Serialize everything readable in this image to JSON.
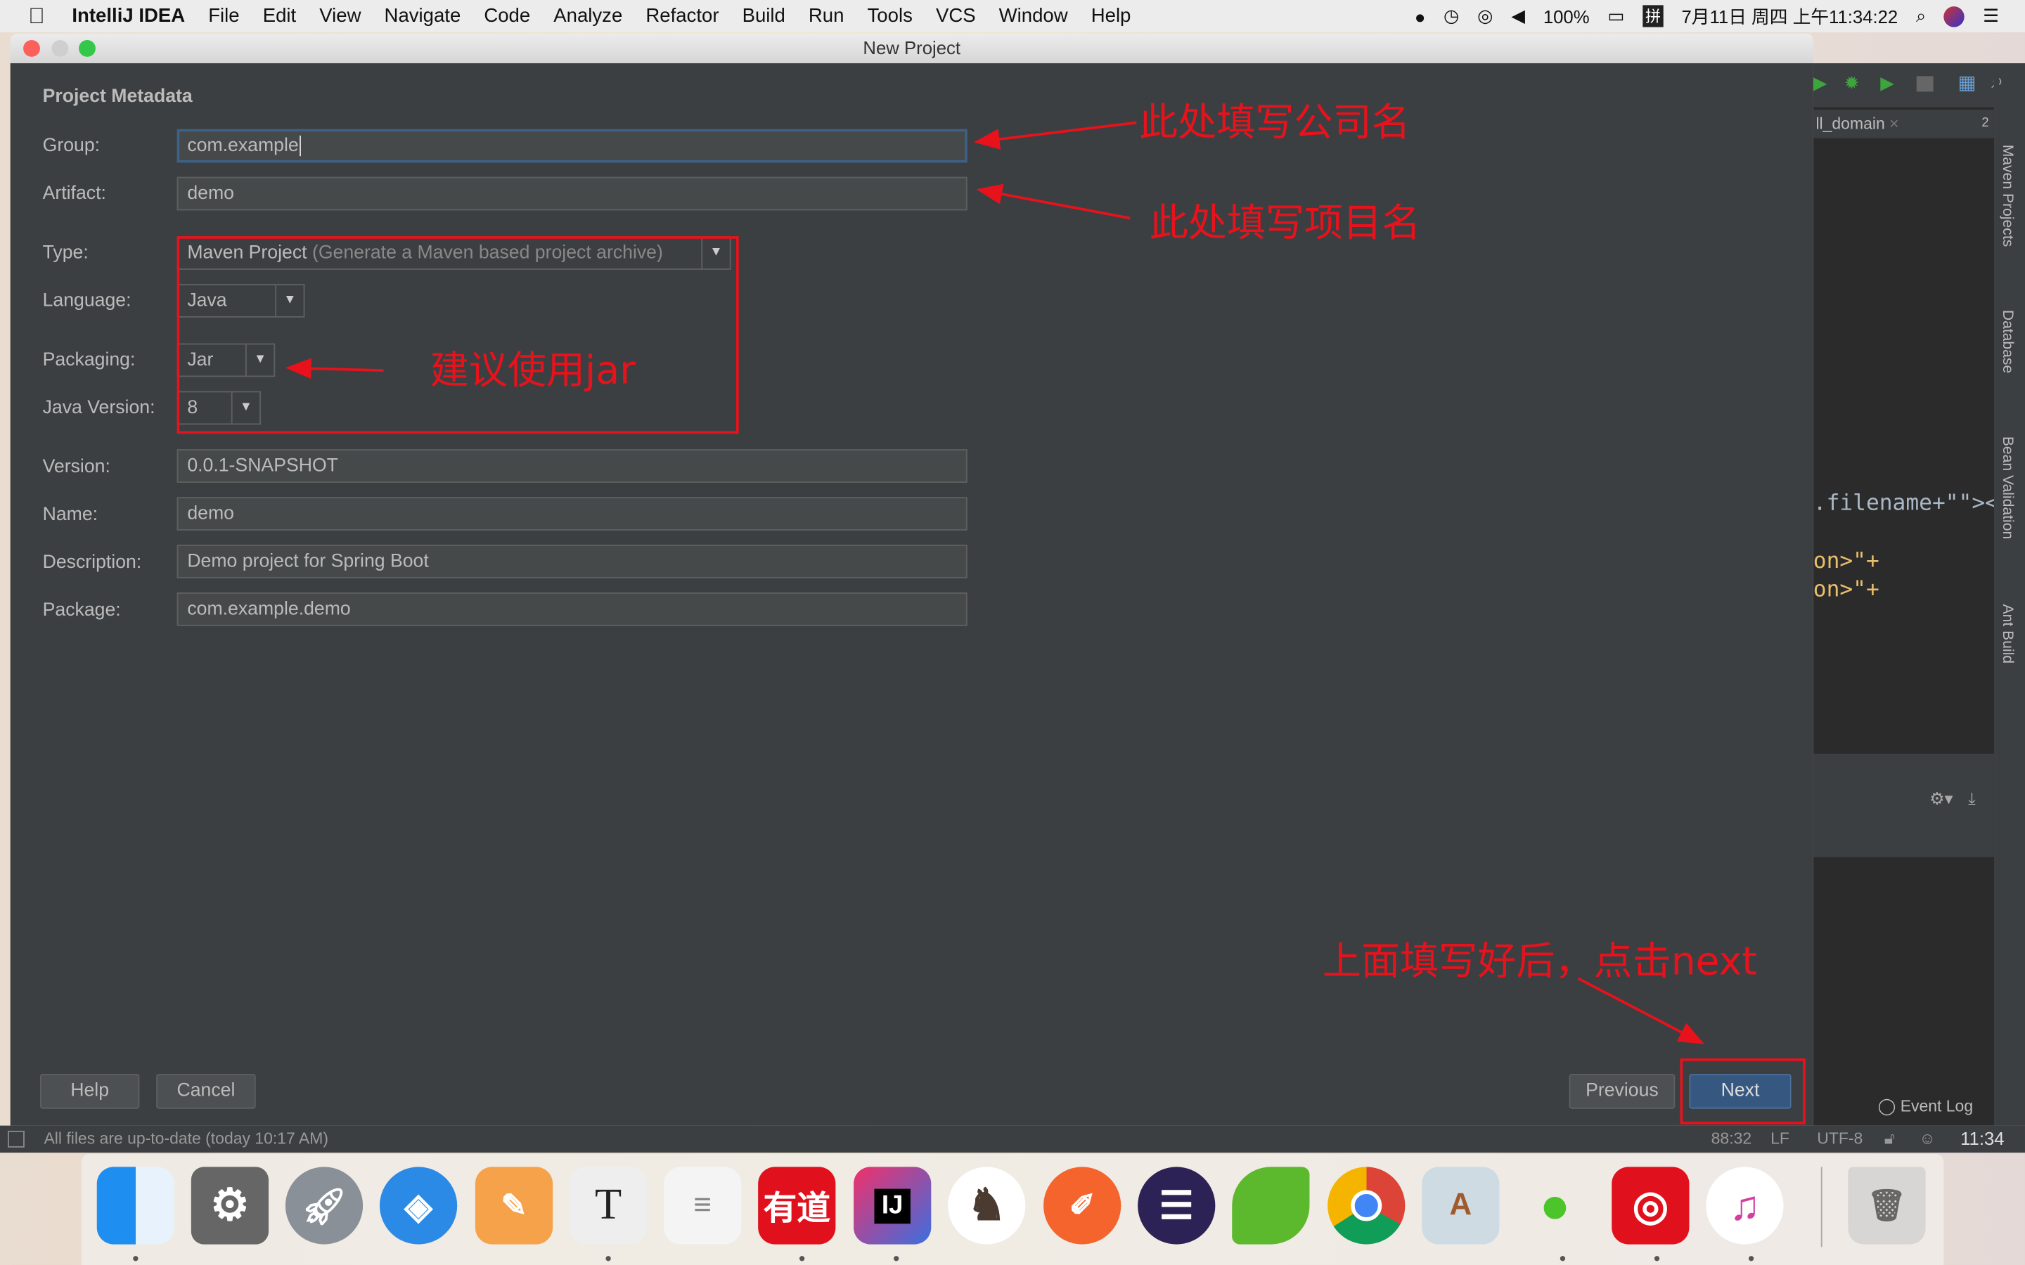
{
  "menubar": {
    "app": "IntelliJ IDEA",
    "items": [
      "File",
      "Edit",
      "View",
      "Navigate",
      "Code",
      "Analyze",
      "Refactor",
      "Build",
      "Run",
      "Tools",
      "VCS",
      "Window",
      "Help"
    ],
    "battery": "100%",
    "input_method": "拼",
    "datetime": "7月11日 周四 上午11:34:22"
  },
  "window": {
    "title": "New Project"
  },
  "form": {
    "section": "Project Metadata",
    "group": {
      "label": "Group:",
      "value": "com.example"
    },
    "artifact": {
      "label": "Artifact:",
      "value": "demo"
    },
    "type": {
      "label": "Type:",
      "value": "Maven Project",
      "hint": "(Generate a Maven based project archive)"
    },
    "language": {
      "label": "Language:",
      "value": "Java"
    },
    "packaging": {
      "label": "Packaging:",
      "value": "Jar"
    },
    "java_version": {
      "label": "Java Version:",
      "value": "8"
    },
    "version": {
      "label": "Version:",
      "value": "0.0.1-SNAPSHOT"
    },
    "name": {
      "label": "Name:",
      "value": "demo"
    },
    "description": {
      "label": "Description:",
      "value": "Demo project for Spring Boot"
    },
    "package": {
      "label": "Package:",
      "value": "com.example.demo"
    }
  },
  "buttons": {
    "help": "Help",
    "cancel": "Cancel",
    "previous": "Previous",
    "next": "Next"
  },
  "annotations": {
    "group": "此处填写公司名",
    "artifact": "此处填写项目名",
    "packaging": "建议使用jar",
    "next": "上面填写好后，点击next",
    "color": "#e8121c"
  },
  "ide": {
    "tab": "ll_domain",
    "tab_count": "2",
    "code1": ".filename+\"\"></",
    "code2": "on>\"+",
    "code3": "on>\"+",
    "side_tools": [
      "Maven Projects",
      "Database",
      "Bean Validation",
      "Ant Build"
    ],
    "event_log": "Event Log"
  },
  "statusbar": {
    "message": "All files are up-to-date (today 10:17 AM)",
    "position": "88:32",
    "line_sep": "LF",
    "encoding": "UTF-8",
    "clock": "11:34"
  },
  "dock": {
    "youdao": "有道",
    "intellij": "IJ",
    "textedit": "T"
  }
}
